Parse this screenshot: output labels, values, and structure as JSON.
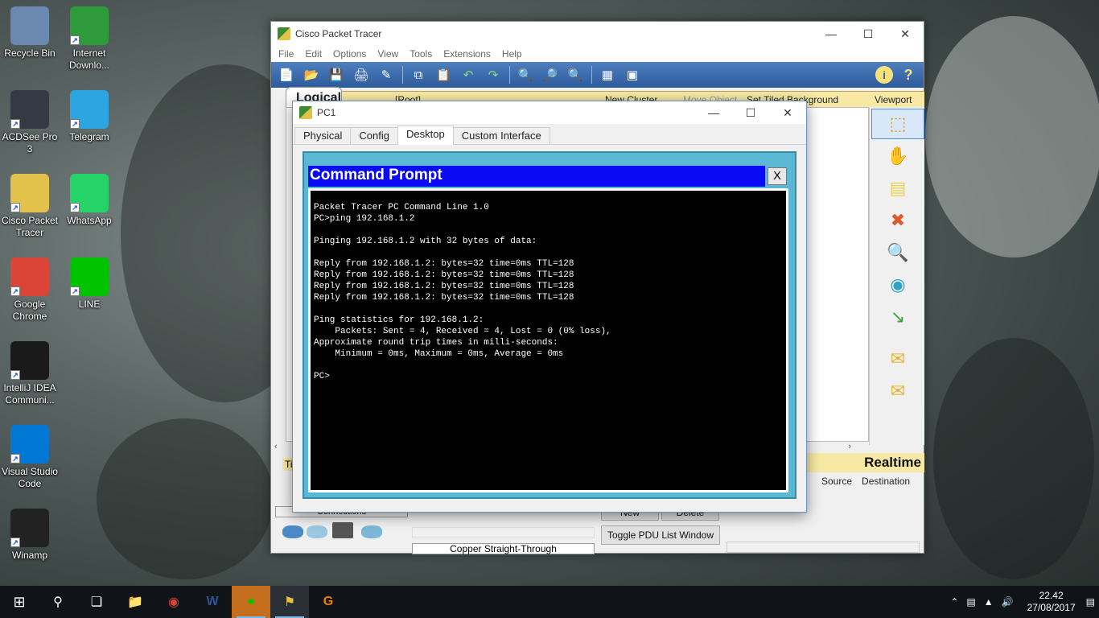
{
  "desktop": {
    "icons": [
      {
        "label": "Recycle Bin",
        "icon": "recycle-bin-icon",
        "color": "#6a88b0"
      },
      {
        "label": "Internet Downlo...",
        "icon": "idm-icon",
        "color": "#2e9a3c"
      },
      {
        "label": "ACDSee Pro 3",
        "icon": "acdsee-icon",
        "color": "#333a44"
      },
      {
        "label": "Telegram",
        "icon": "telegram-icon",
        "color": "#2ca5e0"
      },
      {
        "label": "Cisco Packet Tracer",
        "icon": "packet-tracer-icon",
        "color": "#e2c24a"
      },
      {
        "label": "WhatsApp",
        "icon": "whatsapp-icon",
        "color": "#25d366"
      },
      {
        "label": "Google Chrome",
        "icon": "chrome-icon",
        "color": "#db4437"
      },
      {
        "label": "LINE",
        "icon": "line-icon",
        "color": "#00c300"
      },
      {
        "label": "IntelliJ IDEA Communi...",
        "icon": "intellij-icon",
        "color": "#1a1a1a"
      },
      {
        "label": "Visual Studio Code",
        "icon": "vscode-icon",
        "color": "#0078d4"
      },
      {
        "label": "Winamp",
        "icon": "winamp-icon",
        "color": "#222222"
      }
    ]
  },
  "pt_window": {
    "title": "Cisco Packet Tracer",
    "menu": [
      "File",
      "Edit",
      "Options",
      "View",
      "Tools",
      "Extensions",
      "Help"
    ],
    "workspace_bar": {
      "tab": "Logical",
      "root": "[Root]",
      "new_cluster": "New Cluster",
      "move_object": "Move Object",
      "set_background": "Set Tiled Background",
      "viewport": "Viewport"
    },
    "realtime_label": "Realtime",
    "pdu_columns": [
      "Source",
      "Destination"
    ],
    "new_button": "New",
    "delete_button": "Delete",
    "toggle_pdu": "Toggle PDU List Window",
    "connections_label": "Connections",
    "connection_type": "Copper Straight-Through",
    "time_tab": "Ti"
  },
  "pc1_window": {
    "title": "PC1",
    "tabs": [
      "Physical",
      "Config",
      "Desktop",
      "Custom Interface"
    ],
    "active_tab": "Desktop"
  },
  "command_prompt": {
    "title": "Command Prompt",
    "close": "X",
    "lines": [
      "Packet Tracer PC Command Line 1.0",
      "PC>ping 192.168.1.2",
      "",
      "Pinging 192.168.1.2 with 32 bytes of data:",
      "",
      "Reply from 192.168.1.2: bytes=32 time=0ms TTL=128",
      "Reply from 192.168.1.2: bytes=32 time=0ms TTL=128",
      "Reply from 192.168.1.2: bytes=32 time=0ms TTL=128",
      "Reply from 192.168.1.2: bytes=32 time=0ms TTL=128",
      "",
      "Ping statistics for 192.168.1.2:",
      "    Packets: Sent = 4, Received = 4, Lost = 0 (0% loss),",
      "Approximate round trip times in milli-seconds:",
      "    Minimum = 0ms, Maximum = 0ms, Average = 0ms",
      "",
      "PC>"
    ]
  },
  "taskbar": {
    "time": "22.42",
    "date": "27/08/2017"
  }
}
